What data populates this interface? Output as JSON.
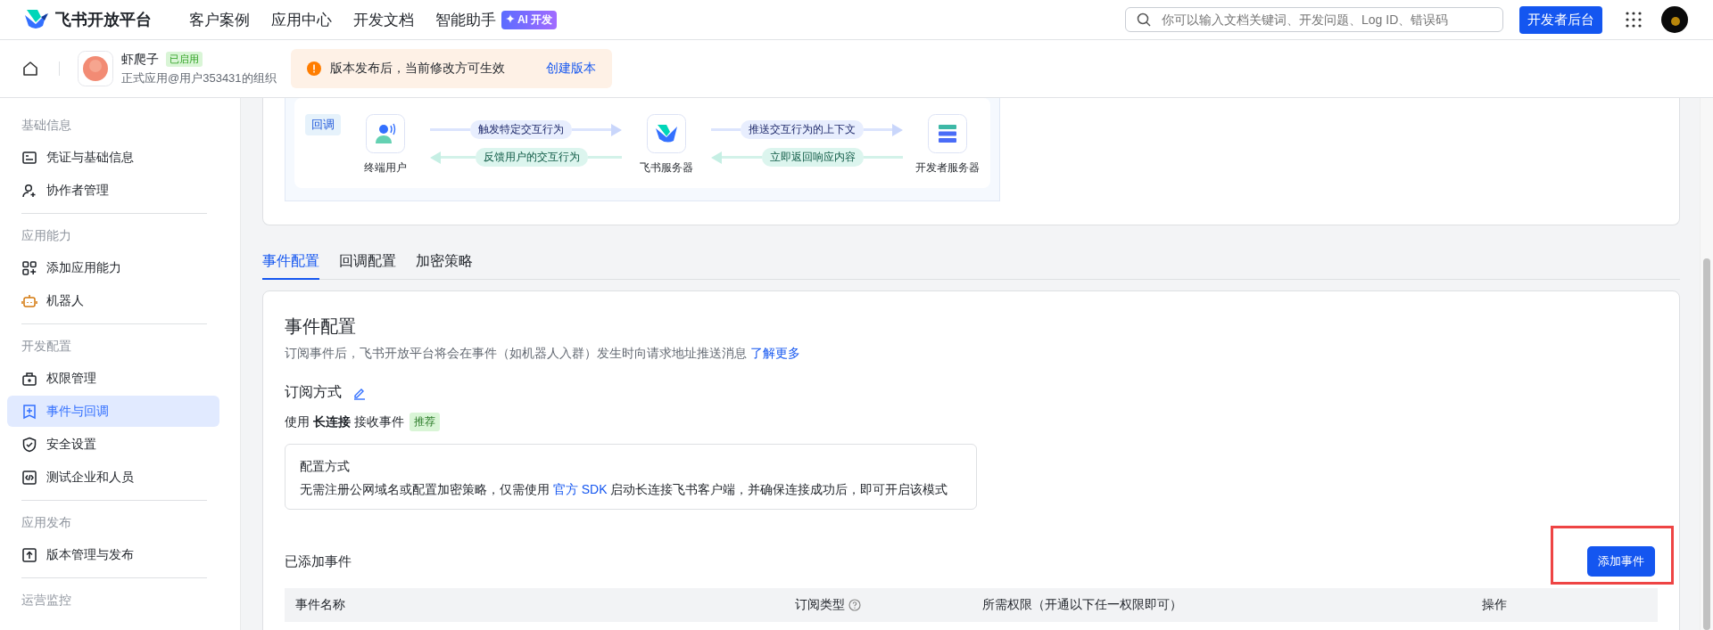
{
  "topbar": {
    "logo": "飞书开放平台",
    "nav": [
      {
        "label": "客户案例"
      },
      {
        "label": "应用中心"
      },
      {
        "label": "开发文档"
      },
      {
        "label": "智能助手",
        "badge": "AI 开发"
      }
    ],
    "search": {
      "placeholder": "你可以输入文档关键词、开发问题、Log ID、错误码"
    },
    "console_button": "开发者后台"
  },
  "app_header": {
    "name": "虾爬子",
    "status": "已启用",
    "org": "正式应用@用户353431的组织",
    "notice": {
      "text": "版本发布后，当前修改方可生效",
      "link": "创建版本"
    }
  },
  "sidebar": {
    "groups": [
      {
        "title": "基础信息",
        "items": [
          {
            "label": "凭证与基础信息",
            "selected": false
          },
          {
            "label": "协作者管理",
            "selected": false
          }
        ]
      },
      {
        "title": "应用能力",
        "items": [
          {
            "label": "添加应用能力",
            "selected": false
          },
          {
            "label": "机器人",
            "selected": false
          }
        ]
      },
      {
        "title": "开发配置",
        "items": [
          {
            "label": "权限管理",
            "selected": false
          },
          {
            "label": "事件与回调",
            "selected": true
          },
          {
            "label": "安全设置",
            "selected": false
          },
          {
            "label": "测试企业和人员",
            "selected": false
          }
        ]
      },
      {
        "title": "应用发布",
        "items": [
          {
            "label": "版本管理与发布",
            "selected": false
          }
        ]
      },
      {
        "title": "运营监控"
      }
    ]
  },
  "flow": {
    "tag": "回调",
    "nodes": [
      {
        "label": "终端用户"
      },
      {
        "label": "飞书服务器"
      },
      {
        "label": "开发者服务器"
      }
    ],
    "links": [
      {
        "forward": "触发特定交互行为",
        "back": "反馈用户的交互行为"
      },
      {
        "forward": "推送交互行为的上下文",
        "back": "立即返回响应内容"
      }
    ]
  },
  "tabs": [
    {
      "label": "事件配置",
      "selected": true
    },
    {
      "label": "回调配置",
      "selected": false
    },
    {
      "label": "加密策略",
      "selected": false
    }
  ],
  "events": {
    "title": "事件配置",
    "description": "订阅事件后，飞书开放平台将会在事件（如机器人入群）发生时向请求地址推送消息",
    "learn_more": "了解更多",
    "subscription": {
      "title": "订阅方式",
      "mode": "使用 **长连接** 接收事件",
      "badge": "推荐"
    },
    "config": {
      "title": "配置方式",
      "text_before": "无需注册公网域名或配置加密策略，仅需使用 ",
      "link": "官方 SDK",
      "text_after": " 启动长连接飞书客户端，并确保连接成功后，即可开启该模式"
    },
    "added": {
      "title": "已添加事件",
      "button": "添加事件",
      "highlighted": true
    },
    "table": {
      "columns": [
        {
          "label": "事件名称",
          "help": false
        },
        {
          "label": "订阅类型",
          "help": true
        },
        {
          "label": "所需权限（开通以下任一权限即可）",
          "help": false
        },
        {
          "label": "操作",
          "help": false
        }
      ]
    }
  }
}
